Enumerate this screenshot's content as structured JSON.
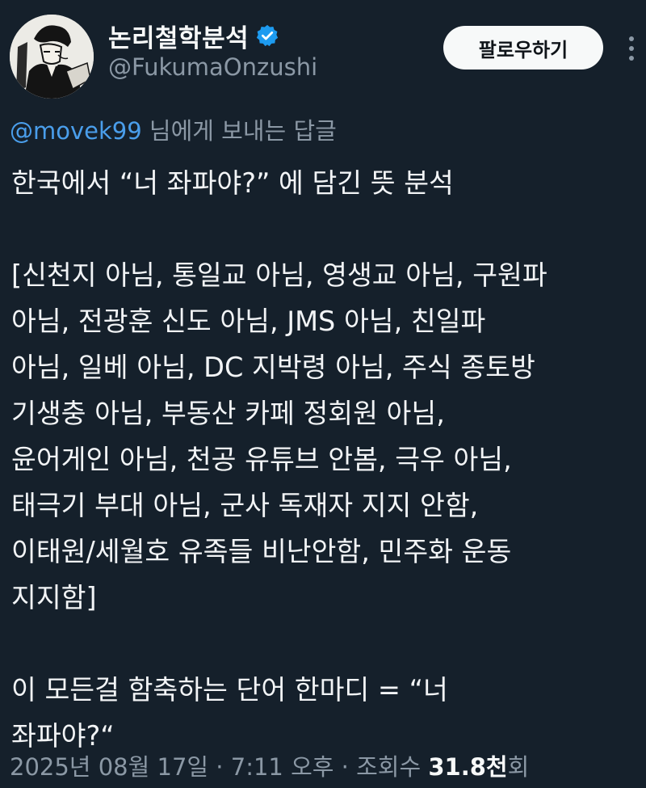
{
  "author": {
    "display_name": "논리철학분석",
    "handle": "@FukumaOnzushi",
    "avatar_icon": "manga-character-avatar",
    "verified_icon": "verified-badge-icon",
    "verified_color": "#1d9bf0"
  },
  "actions": {
    "follow_label": "팔로우하기",
    "more_icon": "more-options-icon"
  },
  "reply_to": {
    "mention": "@movek99",
    "suffix": " 님에게 보내는 답글"
  },
  "tweet": {
    "lines": [
      "한국에서 “너 좌파야?” 에 담긴 뜻 분석",
      "",
      "[신천지 아님, 통일교 아님, 영생교 아님, 구원파",
      "아님, 전광훈 신도 아님, JMS 아님, 친일파",
      "아님, 일베 아님, DC 지박령 아님, 주식 종토방",
      "기생충 아님, 부동산 카페 정회원 아님,",
      "윤어게인 아님, 천공 유튜브 안봄, 극우 아님,",
      "태극기 부대 아님, 군사 독재자 지지 안함,",
      "이태원/세월호 유족들 비난안함, 민주화 운동",
      "지지함]",
      "",
      "이 모든걸 함축하는 단어 한마디 = “너",
      "좌파야?“"
    ]
  },
  "meta": {
    "timestamp": "2025년 08월 17일 · 7:11 오후 · 조회수 ",
    "views_number": "31.8천",
    "views_suffix": "회"
  },
  "colors": {
    "background": "#15202b",
    "text": "#f2f4f6",
    "secondary": "#8b98a5",
    "link": "#4a9eeb"
  }
}
